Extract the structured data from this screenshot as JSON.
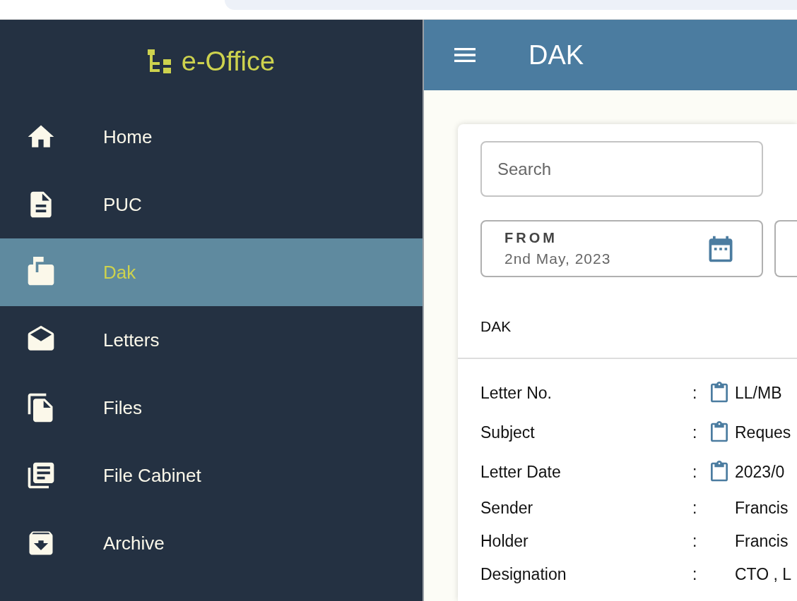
{
  "app": {
    "title": "e-Office"
  },
  "sidebar": {
    "items": [
      {
        "label": "Home",
        "selected": false
      },
      {
        "label": "PUC",
        "selected": false
      },
      {
        "label": "Dak",
        "selected": true
      },
      {
        "label": "Letters",
        "selected": false
      },
      {
        "label": "Files",
        "selected": false
      },
      {
        "label": "File Cabinet",
        "selected": false
      },
      {
        "label": "Archive",
        "selected": false
      }
    ]
  },
  "header": {
    "title": "DAK"
  },
  "search": {
    "placeholder": "Search"
  },
  "date_from": {
    "label": "FROM",
    "value": "2nd May, 2023"
  },
  "section_title": "DAK",
  "details": [
    {
      "kind": "copyable",
      "label": "Letter No.",
      "separator": ":",
      "value": "LL/MB"
    },
    {
      "kind": "copyable",
      "label": "Subject",
      "separator": ":",
      "value": "Reques"
    },
    {
      "kind": "copyable",
      "label": "Letter Date",
      "separator": ":",
      "value": "2023/0"
    },
    {
      "kind": "plain",
      "label": "Sender",
      "separator": ":",
      "value": "Francis"
    },
    {
      "kind": "plain",
      "label": "Holder",
      "separator": ":",
      "value": "Francis"
    },
    {
      "kind": "plain",
      "label": "Designation",
      "separator": ":",
      "value": "CTO , L"
    }
  ]
}
